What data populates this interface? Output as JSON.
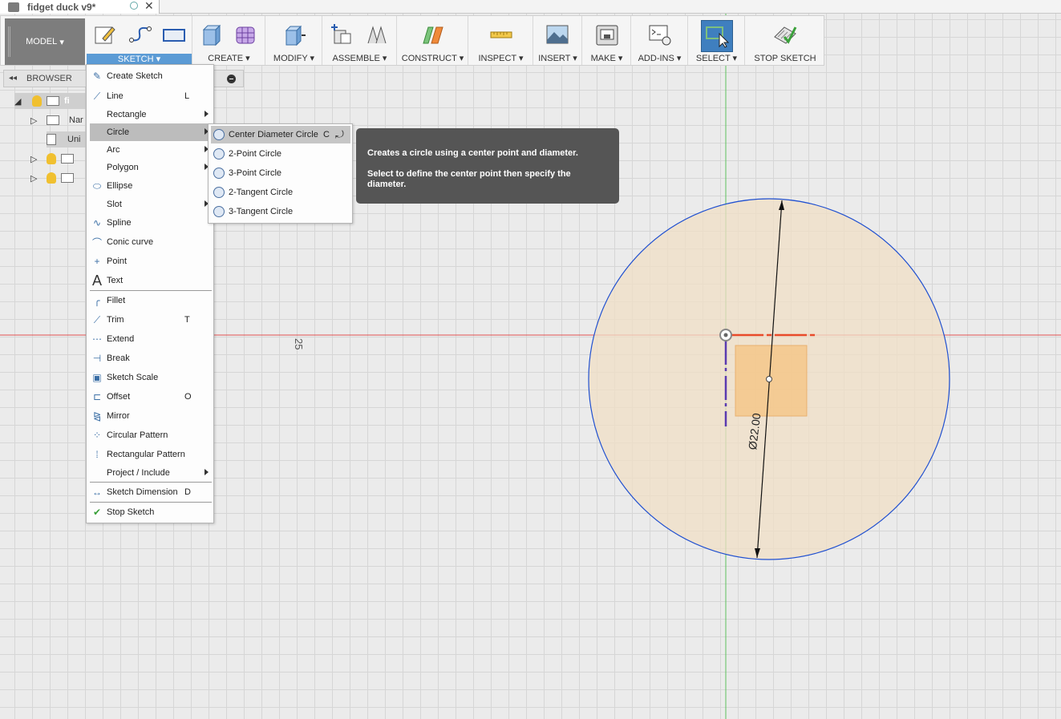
{
  "document": {
    "title": "fidget duck v9*"
  },
  "toolbar": {
    "workspace": "MODEL",
    "groups": [
      {
        "label": "SKETCH",
        "icon": "sketch-icon"
      },
      {
        "label": "CREATE",
        "icon": "box-icon"
      },
      {
        "label": "MODIFY",
        "icon": "press-pull-icon"
      },
      {
        "label": "ASSEMBLE",
        "icon": "joint-icon"
      },
      {
        "label": "CONSTRUCT",
        "icon": "plane-icon"
      },
      {
        "label": "INSPECT",
        "icon": "measure-icon"
      },
      {
        "label": "INSERT",
        "icon": "image-icon"
      },
      {
        "label": "MAKE",
        "icon": "printer-icon"
      },
      {
        "label": "ADD-INS",
        "icon": "scripts-icon"
      },
      {
        "label": "SELECT",
        "icon": "select-icon"
      },
      {
        "label": "STOP SKETCH",
        "icon": "stop-sketch-icon"
      }
    ]
  },
  "browser": {
    "title": "BROWSER",
    "rows": [
      {
        "text": "fi"
      },
      {
        "text": "Nar"
      },
      {
        "text": "Uni"
      }
    ]
  },
  "sketch_menu": {
    "items": [
      {
        "label": "Create Sketch",
        "key": "",
        "submenu": false
      },
      {
        "label": "Line",
        "key": "L",
        "submenu": false
      },
      {
        "label": "Rectangle",
        "key": "",
        "submenu": true
      },
      {
        "label": "Circle",
        "key": "",
        "submenu": true
      },
      {
        "label": "Arc",
        "key": "",
        "submenu": true
      },
      {
        "label": "Polygon",
        "key": "",
        "submenu": true
      },
      {
        "label": "Ellipse",
        "key": "",
        "submenu": false
      },
      {
        "label": "Slot",
        "key": "",
        "submenu": true
      },
      {
        "label": "Spline",
        "key": "",
        "submenu": false
      },
      {
        "label": "Conic curve",
        "key": "",
        "submenu": false
      },
      {
        "label": "Point",
        "key": "",
        "submenu": false
      },
      {
        "label": "Text",
        "key": "",
        "submenu": false
      },
      {
        "label": "Fillet",
        "key": "",
        "submenu": false
      },
      {
        "label": "Trim",
        "key": "T",
        "submenu": false
      },
      {
        "label": "Extend",
        "key": "",
        "submenu": false
      },
      {
        "label": "Break",
        "key": "",
        "submenu": false
      },
      {
        "label": "Sketch Scale",
        "key": "",
        "submenu": false
      },
      {
        "label": "Offset",
        "key": "O",
        "submenu": false
      },
      {
        "label": "Mirror",
        "key": "",
        "submenu": false
      },
      {
        "label": "Circular Pattern",
        "key": "",
        "submenu": false
      },
      {
        "label": "Rectangular Pattern",
        "key": "",
        "submenu": false
      },
      {
        "label": "Project / Include",
        "key": "",
        "submenu": true
      },
      {
        "label": "Sketch Dimension",
        "key": "D",
        "submenu": false
      },
      {
        "label": "Stop Sketch",
        "key": "",
        "submenu": false
      }
    ],
    "highlighted": "Circle"
  },
  "circle_submenu": {
    "items": [
      {
        "label": "Center Diameter Circle",
        "key": "C"
      },
      {
        "label": "2-Point Circle",
        "key": ""
      },
      {
        "label": "3-Point Circle",
        "key": ""
      },
      {
        "label": "2-Tangent Circle",
        "key": ""
      },
      {
        "label": "3-Tangent Circle",
        "key": ""
      }
    ],
    "highlighted": "Center Diameter Circle"
  },
  "tooltip": {
    "line1": "Creates a circle using a center point and diameter.",
    "line2": "Select to define the center point then specify the diameter."
  },
  "canvas": {
    "dimension_label": "Ø22.00",
    "ruler_label": "25",
    "colors": {
      "circle_stroke": "#2050d0",
      "circle_fill": "#f0dfc6",
      "profile_fill": "#f4c78a",
      "x_axis": "#e05050",
      "y_axis": "#5ec05e",
      "accent": "#5b9bd5"
    }
  }
}
